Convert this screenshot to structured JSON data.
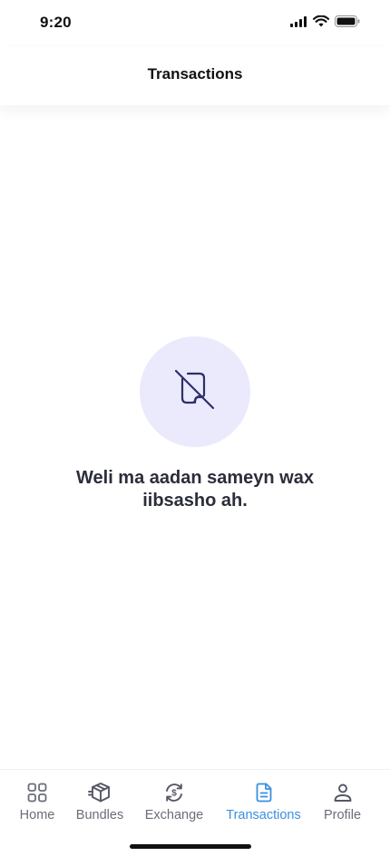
{
  "status": {
    "time": "9:20"
  },
  "header": {
    "title": "Transactions"
  },
  "empty_state": {
    "icon": "no-document-icon",
    "message": "Weli ma aadan sameyn wax iibsasho ah."
  },
  "tabs": [
    {
      "label": "Home",
      "icon": "grid-icon",
      "active": false
    },
    {
      "label": "Bundles",
      "icon": "box-icon",
      "active": false
    },
    {
      "label": "Exchange",
      "icon": "exchange-icon",
      "active": false
    },
    {
      "label": "Transactions",
      "icon": "document-icon",
      "active": true
    },
    {
      "label": "Profile",
      "icon": "person-icon",
      "active": false
    }
  ],
  "colors": {
    "accent": "#3b8fe0",
    "empty_circle": "#ebeafc",
    "icon_dark": "#2d2f6b",
    "tab_inactive": "#6b6d7a"
  }
}
